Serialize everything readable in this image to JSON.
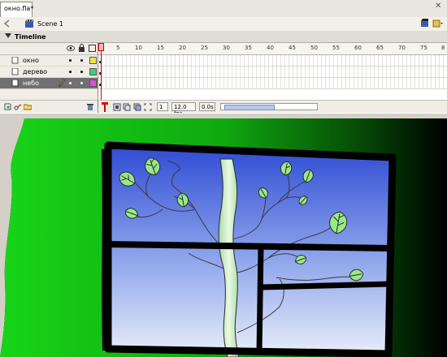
{
  "document": {
    "tab_label": "окно.fla*"
  },
  "scene_bar": {
    "scene_label": "Scene 1"
  },
  "timeline": {
    "title": "Timeline",
    "ruler_ticks": [
      "5",
      "10",
      "15",
      "20",
      "25",
      "30",
      "35",
      "40",
      "45",
      "50",
      "55",
      "60",
      "65",
      "70",
      "75",
      "8"
    ],
    "layers": [
      {
        "name": "окно",
        "swatch": "#f4e24a",
        "selected": false
      },
      {
        "name": "дерево",
        "swatch": "#3cd07a",
        "selected": false
      },
      {
        "name": "небо",
        "swatch": "#e04fd6",
        "selected": true
      }
    ],
    "current_frame": "1",
    "fps": "12.0 fps",
    "elapsed": "0.0s"
  },
  "colors": {
    "stage_green": "#1fd21f",
    "sky_top": "#3a57d8",
    "sky_bottom": "#dfe6f6",
    "leaf": "#8fe07a",
    "trunk": "#c8eec0"
  }
}
